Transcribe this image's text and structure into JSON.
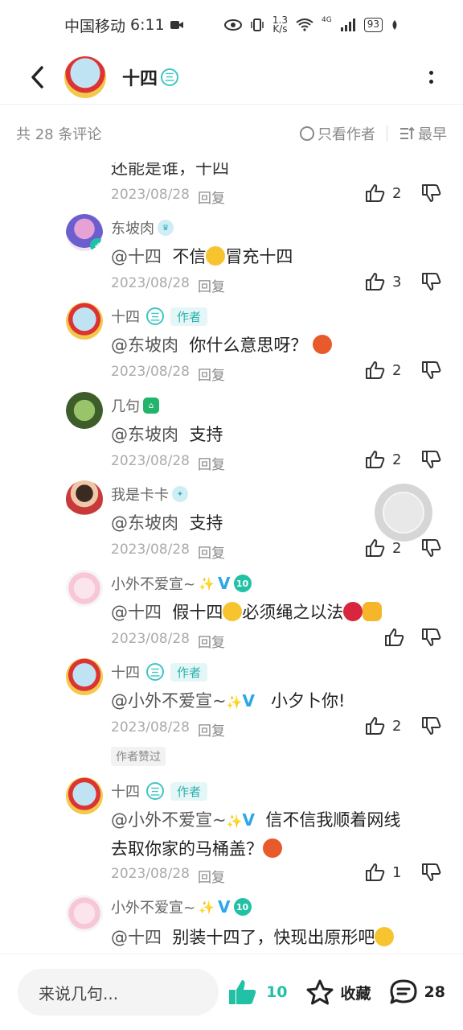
{
  "status_bar": {
    "carrier": "中国移动",
    "time": "6:11",
    "speed_top": "1.3",
    "speed_bottom": "K/s",
    "network": "4G",
    "battery": "93"
  },
  "header": {
    "title": "十四",
    "level_badge": "三"
  },
  "toolbar": {
    "count_text": "共 28 条评论",
    "only_author": "只看作者",
    "sort": "最早"
  },
  "comments": [
    {
      "content_partial": "还能是谁，十四",
      "date": "2023/08/28",
      "reply": "回复",
      "likes": "2"
    },
    {
      "user": "东坡肉",
      "at": "@十四",
      "text_a": "不信",
      "text_b": "冒充十四",
      "date": "2023/08/28",
      "reply": "回复",
      "likes": "3"
    },
    {
      "user": "十四",
      "badge": "三",
      "author_tag": "作者",
      "at": "@东坡肉",
      "text_a": "你什么意思呀？",
      "date": "2023/08/28",
      "reply": "回复",
      "likes": "2"
    },
    {
      "user": "几句",
      "at": "@东坡肉",
      "text_a": "支持",
      "date": "2023/08/28",
      "reply": "回复",
      "likes": "2"
    },
    {
      "user": "我是卡卡",
      "at": "@东坡肉",
      "text_a": "支持",
      "date": "2023/08/28",
      "reply": "回复",
      "likes": "2"
    },
    {
      "user": "小外不爱宣~",
      "v": "V",
      "lv": "10",
      "at": "@十四",
      "text_a": "假十四",
      "text_b": "必须绳之以法",
      "date": "2023/08/28",
      "reply": "回复",
      "likes": ""
    },
    {
      "user": "十四",
      "badge": "三",
      "author_tag": "作者",
      "at": "@小外不爱宣~",
      "v": "V",
      "text_a": "小夕卜你!",
      "date": "2023/08/28",
      "reply": "回复",
      "likes": "2",
      "liked_by_author": "作者赞过"
    },
    {
      "user": "十四",
      "badge": "三",
      "author_tag": "作者",
      "at": "@小外不爱宣~",
      "v": "V",
      "text_a": "信不信我顺着网线",
      "text_b": "去取你家的马桶盖？",
      "date": "2023/08/28",
      "reply": "回复",
      "likes": "1"
    },
    {
      "user": "小外不爱宣~",
      "v": "V",
      "lv": "10",
      "at": "@十四",
      "text_a": "别装十四了，快现出原形吧"
    }
  ],
  "bottom": {
    "input_placeholder": "来说几句...",
    "like_count": "10",
    "fav_label": "收藏",
    "comment_count": "28"
  }
}
